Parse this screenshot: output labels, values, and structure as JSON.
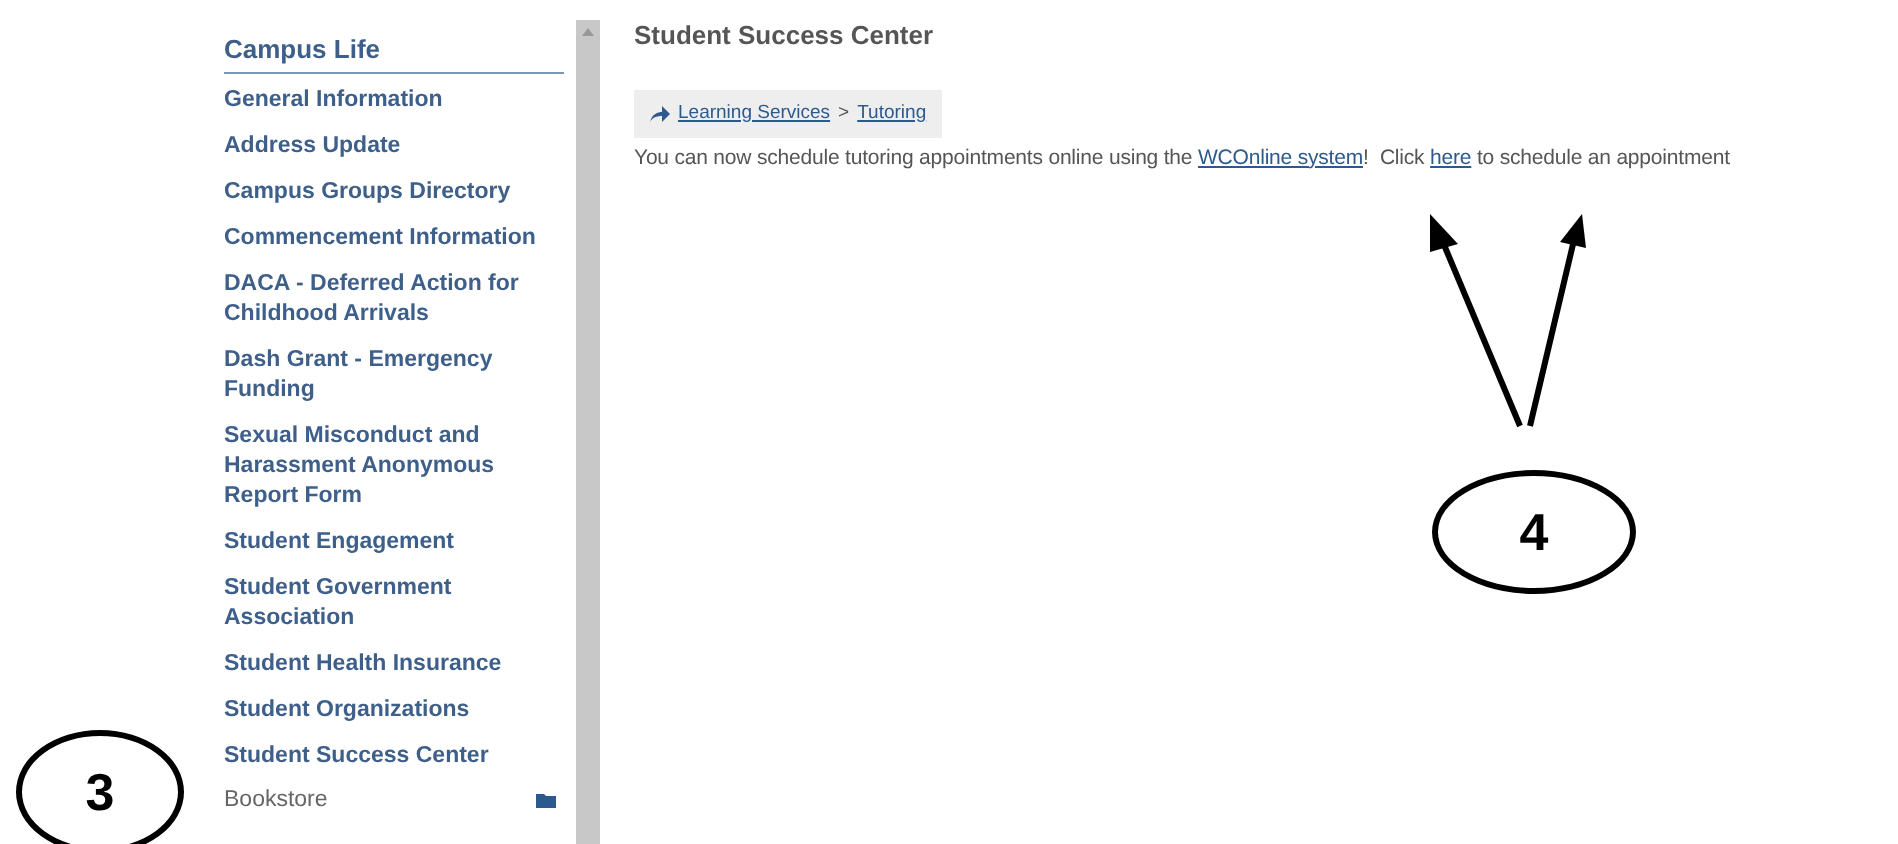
{
  "sidebar": {
    "title": "Campus Life",
    "items": [
      {
        "label": "General Information",
        "kind": "link"
      },
      {
        "label": "Address Update",
        "kind": "link"
      },
      {
        "label": "Campus Groups Directory",
        "kind": "link"
      },
      {
        "label": "Commencement Information",
        "kind": "link"
      },
      {
        "label": "DACA - Deferred Action for Childhood Arrivals",
        "kind": "link"
      },
      {
        "label": "Dash Grant - Emergency Funding",
        "kind": "link"
      },
      {
        "label": "Sexual Misconduct and Harassment Anonymous Report Form",
        "kind": "link"
      },
      {
        "label": "Student Engagement",
        "kind": "link"
      },
      {
        "label": "Student Government Association",
        "kind": "link"
      },
      {
        "label": "Student Health Insurance",
        "kind": "link"
      },
      {
        "label": "Student Organizations",
        "kind": "link"
      },
      {
        "label": "Student Success Center",
        "kind": "link"
      },
      {
        "label": "Bookstore",
        "kind": "folder"
      }
    ]
  },
  "content": {
    "title": "Student Success Center",
    "breadcrumb": [
      {
        "label": "Learning Services"
      },
      {
        "label": "Tutoring"
      }
    ],
    "separator": ">",
    "message": [
      {
        "kind": "text",
        "text": "You can now schedule tutoring appointments online using the "
      },
      {
        "kind": "link",
        "text": "WCOnline system"
      },
      {
        "kind": "text",
        "text": "!  Click "
      },
      {
        "kind": "link",
        "text": "here"
      },
      {
        "kind": "text",
        "text": " to schedule an appointment"
      }
    ]
  },
  "annotations": [
    {
      "label": "3"
    },
    {
      "label": "4"
    }
  ]
}
